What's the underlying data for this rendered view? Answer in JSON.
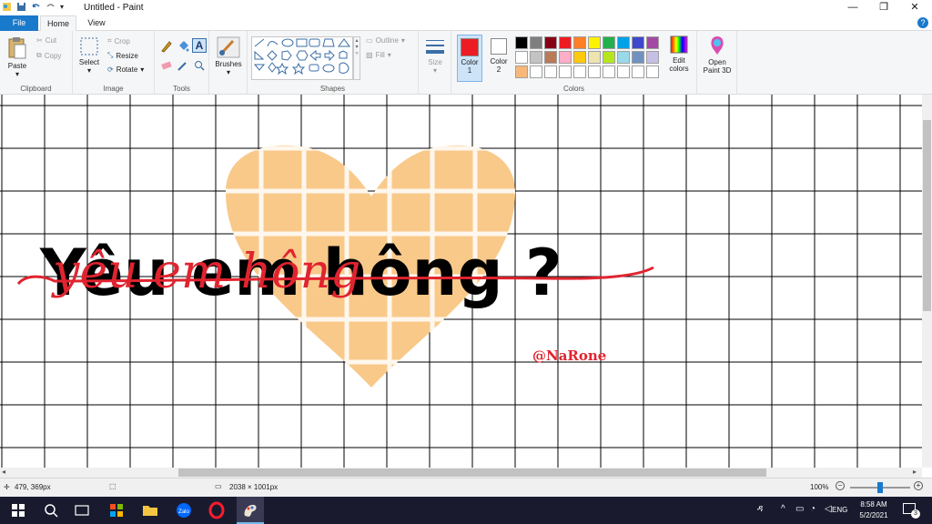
{
  "window": {
    "title": "Untitled - Paint"
  },
  "tabs": [
    "File",
    "Home",
    "View"
  ],
  "ribbon": {
    "clipboard": {
      "label": "Clipboard",
      "paste": "Paste",
      "cut": "Cut",
      "copy": "Copy"
    },
    "image": {
      "label": "Image",
      "select": "Select",
      "crop": "Crop",
      "resize": "Resize",
      "rotate": "Rotate"
    },
    "tools": {
      "label": "Tools"
    },
    "brushes": {
      "label": "Brushes"
    },
    "shapes": {
      "label": "Shapes",
      "outline": "Outline",
      "fill": "Fill"
    },
    "size": {
      "label": "Size"
    },
    "colors": {
      "label": "Colors",
      "color1": "Color\n1",
      "color2": "Color\n2",
      "edit": "Edit\ncolors",
      "color1_value": "#ed1c24",
      "color2_value": "#ffffff",
      "palette_row1": [
        "#000000",
        "#7f7f7f",
        "#880015",
        "#ed1c24",
        "#ff7f27",
        "#fff200",
        "#22b14c",
        "#00a2e8",
        "#3f48cc",
        "#a349a4"
      ],
      "palette_row2": [
        "#ffffff",
        "#c3c3c3",
        "#b97a57",
        "#ffaec9",
        "#ffc90e",
        "#efe4b0",
        "#b5e61d",
        "#99d9ea",
        "#7092be",
        "#c8bfe7"
      ],
      "palette_row3": [
        "#f7b87a",
        "#ffffff",
        "#ffffff",
        "#ffffff",
        "#ffffff",
        "#ffffff",
        "#ffffff",
        "#ffffff",
        "#ffffff",
        "#ffffff"
      ]
    },
    "paint3d": {
      "label": "Open\nPaint 3D"
    }
  },
  "canvas": {
    "main_text": "Yêu em hông ?",
    "script_text": "yêu em hông",
    "signature": "@NaRone",
    "heart_color": "#f9c98a",
    "text_color": "#000000",
    "script_color": "#e0242f"
  },
  "status": {
    "cursor_pos": "479, 369px",
    "image_size": "2038 × 1001px",
    "zoom": "100%",
    "zoom_level": 0.5
  },
  "taskbar": {
    "language": "ENG",
    "time": "8:58 AM",
    "date": "5/2/2021",
    "notifications": "3"
  }
}
